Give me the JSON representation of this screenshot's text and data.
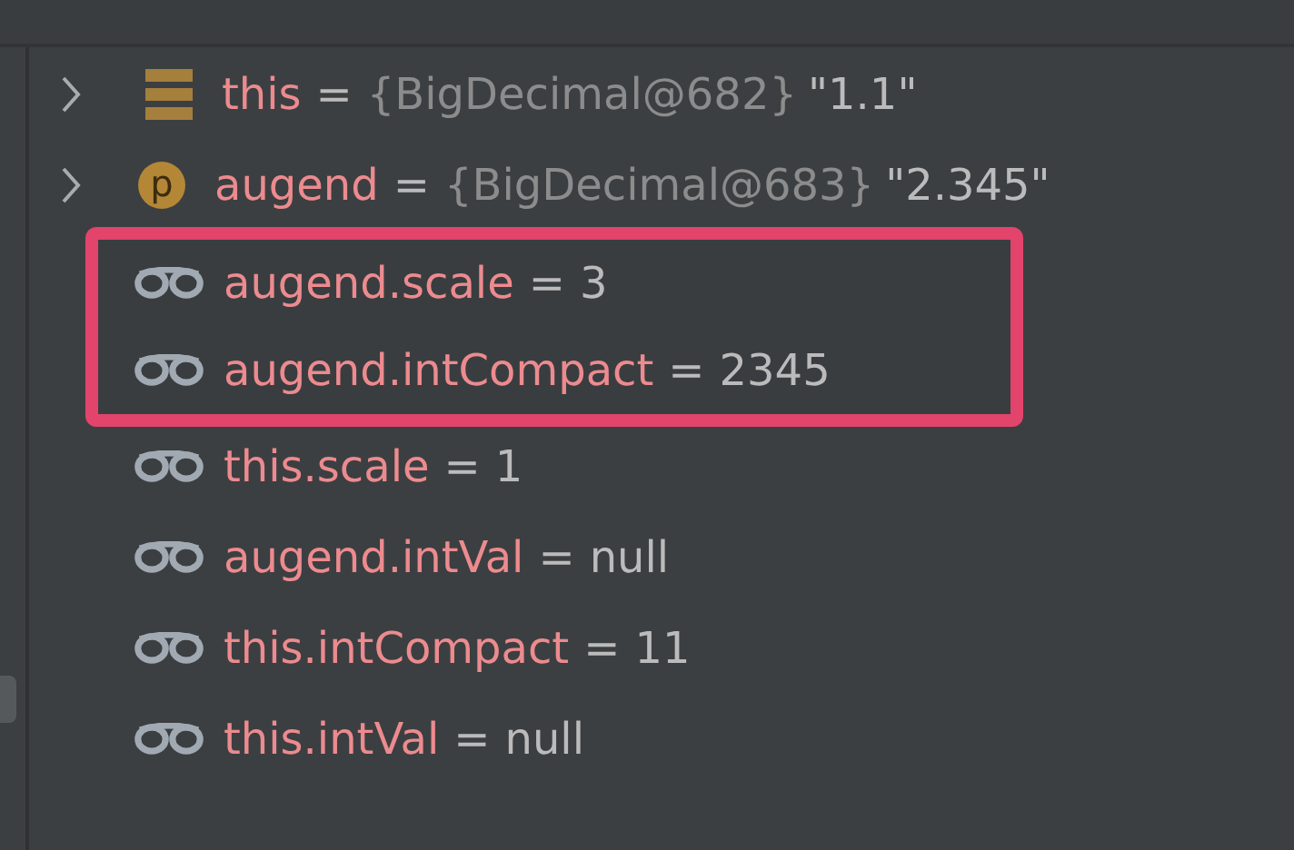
{
  "variables_above": [
    {
      "kind": "field",
      "expanded": false,
      "name": "this",
      "sign": "=",
      "type": "{BigDecimal@682}",
      "value": "\"1.1\""
    },
    {
      "kind": "parameter",
      "icon_letter": "p",
      "expanded": false,
      "name": "augend",
      "sign": "=",
      "type": "{BigDecimal@683}",
      "value": "\"2.345\""
    }
  ],
  "highlight_frame": {
    "rows": [
      {
        "kind": "watch",
        "name": "augend.scale",
        "sign": "=",
        "value": "3"
      },
      {
        "kind": "watch",
        "name": "augend.intCompact",
        "sign": "=",
        "value": "2345"
      }
    ]
  },
  "variables_below": [
    {
      "kind": "watch",
      "name": "this.scale",
      "sign": "=",
      "value": "1"
    },
    {
      "kind": "watch",
      "name": "augend.intVal",
      "sign": "=",
      "value": "null"
    },
    {
      "kind": "watch",
      "name": "this.intCompact",
      "sign": "=",
      "value": "11"
    },
    {
      "kind": "watch",
      "name": "this.intVal",
      "sign": "=",
      "value": "null"
    }
  ]
}
